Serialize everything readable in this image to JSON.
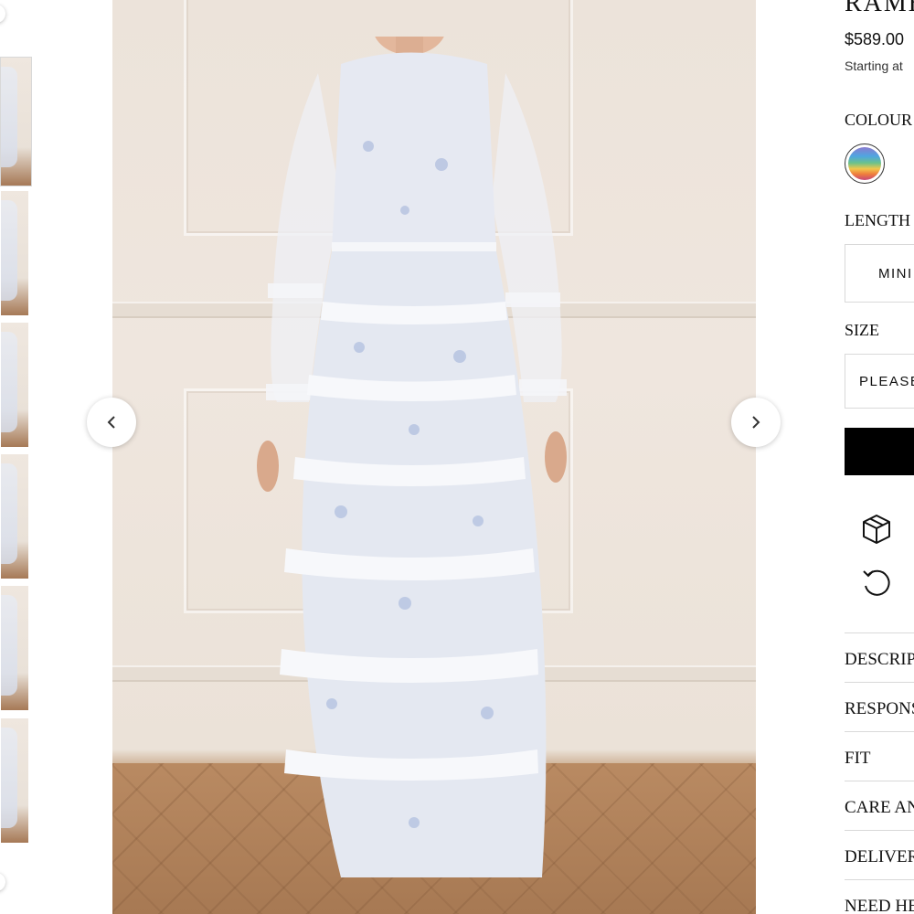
{
  "product": {
    "title": "RAMB",
    "price": "$589.00",
    "installments_text": "Starting at"
  },
  "options": {
    "colour_label": "COLOUR",
    "length_label": "LENGTH",
    "length_value": "MINI",
    "size_label": "SIZE",
    "size_placeholder": "PLEASE"
  },
  "services": {
    "delivery_icon": "box-icon",
    "returns_icon": "returns-icon"
  },
  "accordion": [
    {
      "label": "DESCRIP"
    },
    {
      "label": "RESPONS"
    },
    {
      "label": "FIT"
    },
    {
      "label": "CARE AN"
    },
    {
      "label": "DELIVER"
    },
    {
      "label": "NEED HE"
    }
  ],
  "gallery": {
    "prev_icon": "chevron-left-icon",
    "next_icon": "chevron-right-icon",
    "thumbnail_count": 6
  }
}
